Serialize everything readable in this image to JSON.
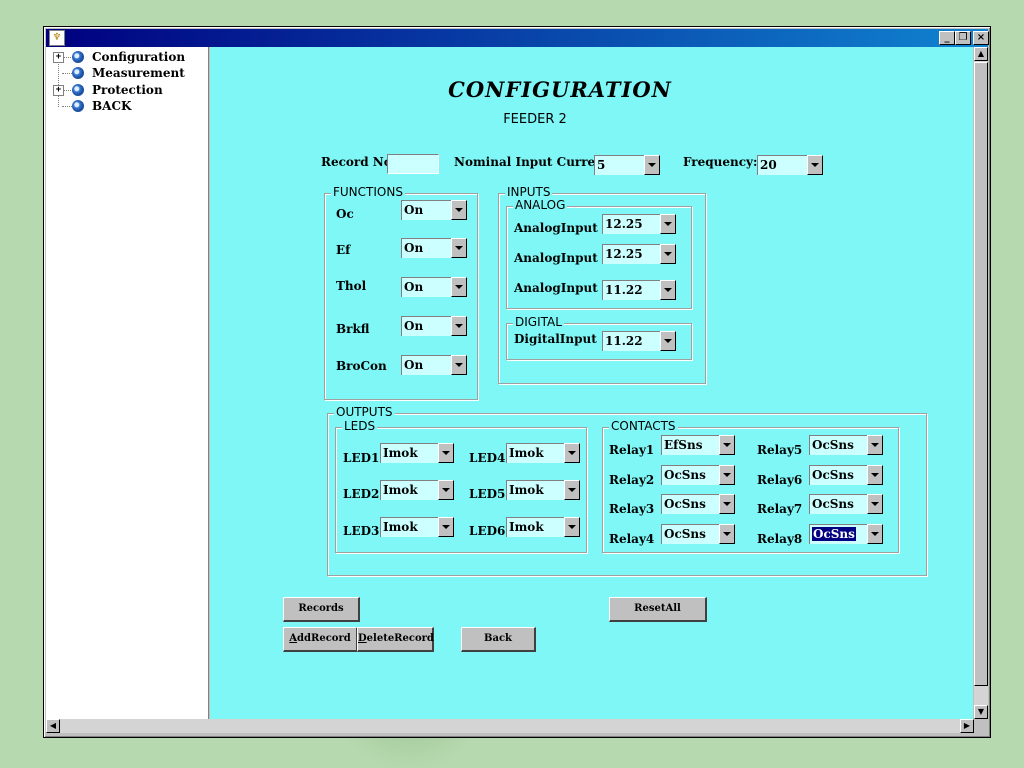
{
  "window": {
    "icon": "app-icon",
    "controls": {
      "minimize": "_",
      "maximize": "❐",
      "close": "×"
    }
  },
  "tree": {
    "items": [
      {
        "label": "Configuration",
        "expandable": true,
        "expander": "+"
      },
      {
        "label": "Measurement",
        "expandable": false
      },
      {
        "label": "Protection",
        "expandable": true,
        "expander": "+"
      },
      {
        "label": "BACK",
        "expandable": false
      }
    ]
  },
  "form": {
    "title": "CONFIGURATION",
    "subtitle": "FEEDER 2",
    "record_no_label": "Record No",
    "record_no_value": "",
    "nominal_label": "Nominal Input Current:",
    "nominal_value": "5",
    "frequency_label": "Frequency:",
    "frequency_value": "20"
  },
  "functions": {
    "title": "FUNCTIONS",
    "rows": [
      {
        "label": "Oc",
        "value": "On"
      },
      {
        "label": "Ef",
        "value": "On"
      },
      {
        "label": "Thol",
        "value": "On"
      },
      {
        "label": "Brkfl",
        "value": "On"
      },
      {
        "label": "BroCon",
        "value": "On"
      }
    ]
  },
  "inputs": {
    "title": "INPUTS",
    "analog_title": "ANALOG",
    "analog": [
      {
        "label": "AnalogInput",
        "value": "12.25"
      },
      {
        "label": "AnalogInput",
        "value": "12.25"
      },
      {
        "label": "AnalogInput",
        "value": "11.22"
      }
    ],
    "digital_title": "DIGITAL",
    "digital": [
      {
        "label": "DigitalInput",
        "value": "11.22"
      }
    ]
  },
  "outputs": {
    "title": "OUTPUTS",
    "leds_title": "LEDS",
    "leds": [
      {
        "label": "LED1",
        "value": "Imok"
      },
      {
        "label": "LED2",
        "value": "Imok"
      },
      {
        "label": "LED3",
        "value": "Imok"
      },
      {
        "label": "LED4",
        "value": "Imok"
      },
      {
        "label": "LED5",
        "value": "Imok"
      },
      {
        "label": "LED6",
        "value": "Imok"
      }
    ],
    "contacts_title": "CONTACTS",
    "relays": [
      {
        "label": "Relay1",
        "value": "EfSns"
      },
      {
        "label": "Relay2",
        "value": "OcSns"
      },
      {
        "label": "Relay3",
        "value": "OcSns"
      },
      {
        "label": "Relay4",
        "value": "OcSns"
      },
      {
        "label": "Relay5",
        "value": "OcSns"
      },
      {
        "label": "Relay6",
        "value": "OcSns"
      },
      {
        "label": "Relay7",
        "value": "OcSns"
      },
      {
        "label": "Relay8",
        "value": "OcSns",
        "selected": true
      }
    ]
  },
  "buttons": {
    "records": "Records",
    "reset_all": "ResetAll",
    "add_record_accel": "A",
    "add_record_rest": "ddRecord",
    "delete_record_accel": "D",
    "delete_record_rest": "eleteRecord",
    "back": "Back"
  },
  "colors": {
    "content_bg": "#7ff7f7",
    "field_bg": "#ccffff",
    "titlebar_start": "#000080",
    "titlebar_end": "#1084d0",
    "selection": "#000080"
  }
}
